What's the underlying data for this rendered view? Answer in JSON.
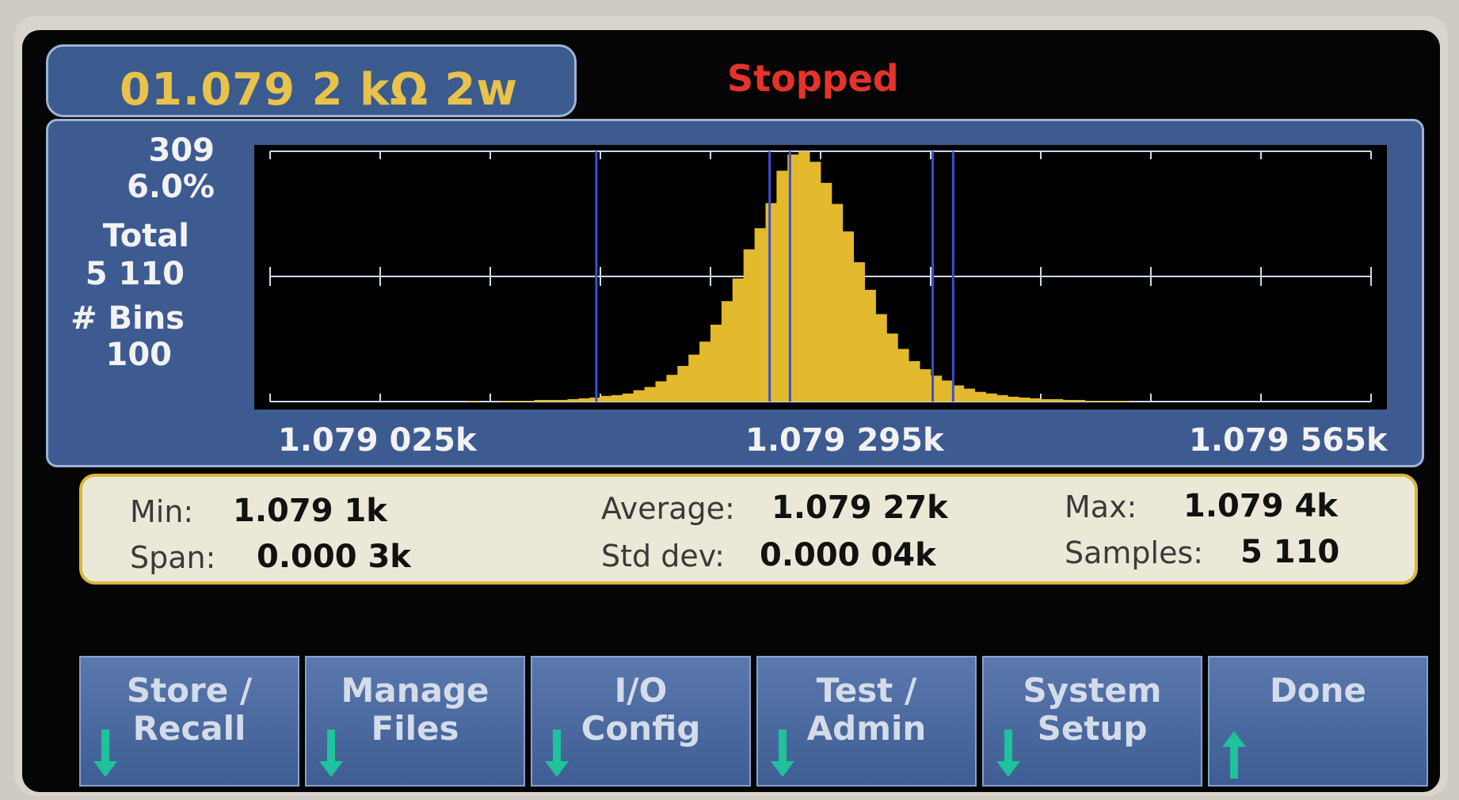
{
  "header": {
    "reading": "01.079 2 kΩ 2w",
    "status": "Stopped"
  },
  "histogram_panel": {
    "peak_count": "309",
    "peak_percent": "6.0%",
    "total_label": "Total",
    "total_value": "5 110",
    "bins_label": "# Bins",
    "bins_value": "100",
    "x_labels": [
      "1.079 025k",
      "1.079 295k",
      "1.079 565k"
    ]
  },
  "stats": {
    "min_label": "Min:",
    "min_value": "1.079 1k",
    "span_label": "Span:",
    "span_value": "0.000 3k",
    "avg_label": "Average:",
    "avg_value": "1.079 27k",
    "std_label": "Std dev:",
    "std_value": "0.000 04k",
    "max_label": "Max:",
    "max_value": "1.079 4k",
    "samples_label": "Samples:",
    "samples_value": "5 110"
  },
  "softkeys": [
    {
      "label": "Store /\nRecall",
      "arrow": "down-arrow-icon"
    },
    {
      "label": "Manage\nFiles",
      "arrow": "down-arrow-icon"
    },
    {
      "label": "I/O\nConfig",
      "arrow": "down-arrow-icon"
    },
    {
      "label": "Test /\nAdmin",
      "arrow": "down-arrow-icon"
    },
    {
      "label": "System\nSetup",
      "arrow": "down-arrow-icon"
    },
    {
      "label": "Done",
      "arrow": "up-arrow-icon"
    }
  ],
  "colors": {
    "bar": "#e3b92e",
    "marker_line": "#3a4fd0",
    "reading": "#e8c24a",
    "status": "#e5332c",
    "arrow": "#1fc29a"
  },
  "chart_data": {
    "type": "bar",
    "bins": 100,
    "x_range": [
      1.079025,
      1.079565
    ],
    "y_max": 309,
    "values": [
      0,
      0,
      0,
      0,
      0,
      0,
      0,
      0,
      0,
      0,
      0,
      0,
      0,
      0,
      0,
      0,
      0,
      0,
      1,
      0,
      0,
      1,
      1,
      1,
      2,
      2,
      2,
      3,
      4,
      5,
      7,
      8,
      10,
      14,
      18,
      25,
      33,
      44,
      58,
      74,
      95,
      124,
      152,
      188,
      214,
      245,
      285,
      305,
      309,
      296,
      270,
      244,
      210,
      172,
      138,
      108,
      84,
      65,
      50,
      40,
      32,
      26,
      20,
      16,
      12,
      10,
      8,
      6,
      5,
      4,
      3,
      3,
      2,
      2,
      1,
      1,
      1,
      1,
      0,
      0,
      0,
      0,
      0,
      0,
      0,
      0,
      0,
      0,
      0,
      0,
      0,
      0,
      0,
      0,
      0,
      0,
      0,
      0,
      0,
      0
    ],
    "markers": [
      1.079185,
      1.07927,
      1.07928,
      1.07935,
      1.07936
    ]
  }
}
